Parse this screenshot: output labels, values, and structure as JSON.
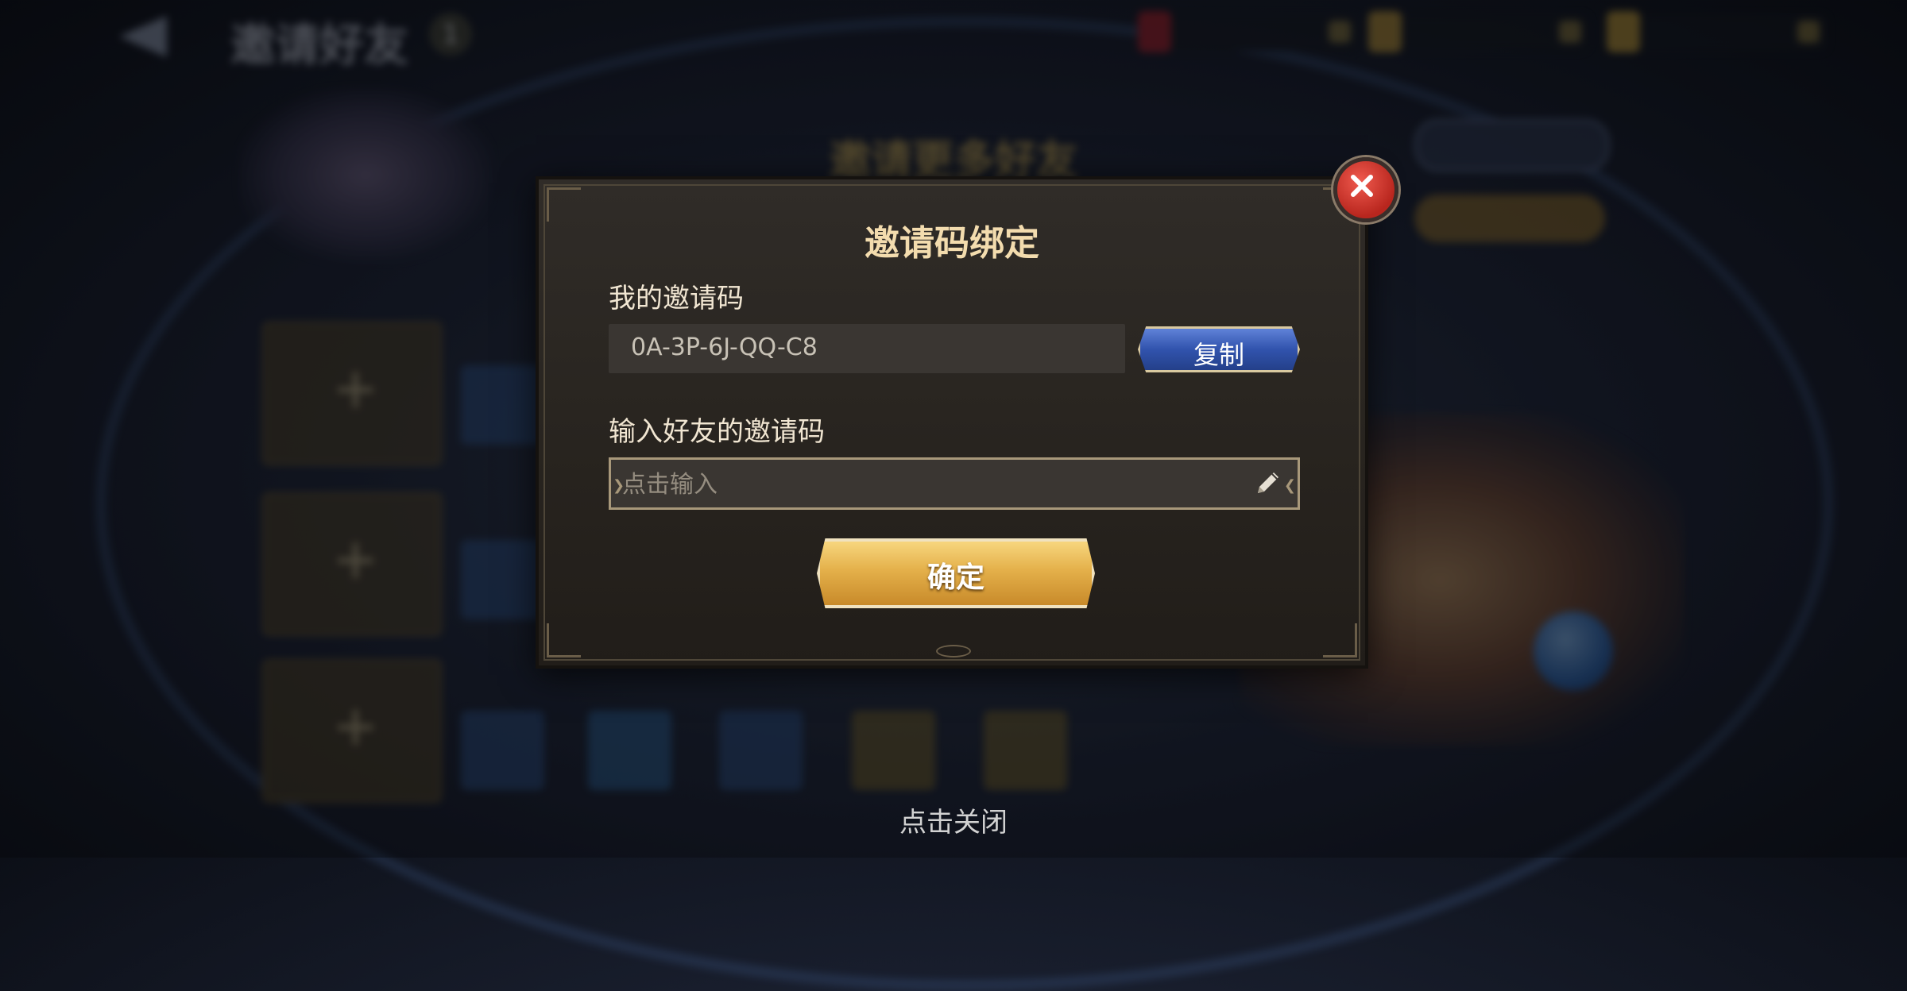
{
  "background": {
    "title": "邀请好友",
    "badge_count": "1",
    "banner": "邀请更多好友"
  },
  "modal": {
    "title": "邀请码绑定",
    "my_code_label": "我的邀请码",
    "my_code_value": "0A-3P-6J-QQ-C8",
    "copy_label": "复制",
    "friend_code_label": "输入好友的邀请码",
    "friend_code_value": "",
    "friend_code_placeholder": "点击输入",
    "confirm_label": "确定",
    "close_icon": "close-icon",
    "edit_icon": "pencil-icon"
  },
  "footer": {
    "tap_to_close": "点击关闭"
  },
  "colors": {
    "title_gold": "#f3dcae",
    "copy_blue": "#3153ad",
    "confirm_gold": "#e4b04a",
    "close_red": "#d0362c"
  }
}
